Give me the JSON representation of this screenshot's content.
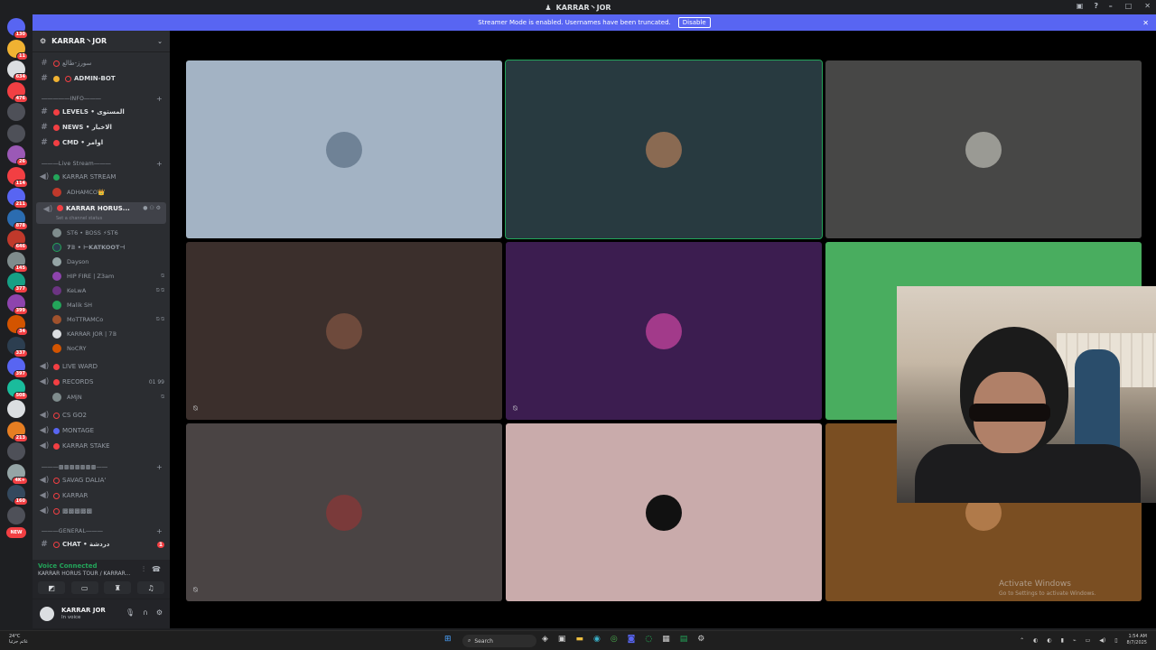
{
  "window": {
    "title": "KARRAR丶JOR"
  },
  "banner": {
    "text": "Streamer Mode is enabled. Usernames have been truncated.",
    "button": "Disable"
  },
  "guilds": [
    {
      "badge": "130",
      "color": "#5865f2"
    },
    {
      "badge": "11",
      "color": "#f0b232"
    },
    {
      "badge": "634",
      "color": "#dbdee1"
    },
    {
      "badge": "476",
      "color": "#f23f43"
    },
    {
      "badge": "",
      "color": "#4e5058"
    },
    {
      "badge": "",
      "color": "#4e5058"
    },
    {
      "badge": "26",
      "color": "#9b59b6"
    },
    {
      "badge": "114",
      "color": "#f23f43"
    },
    {
      "badge": "211",
      "color": "#5865f2"
    },
    {
      "badge": "878",
      "color": "#2b6cb0"
    },
    {
      "badge": "646",
      "color": "#c0392b"
    },
    {
      "badge": "145",
      "color": "#7f8c8d"
    },
    {
      "badge": "377",
      "color": "#16a085"
    },
    {
      "badge": "399",
      "color": "#8e44ad"
    },
    {
      "badge": "34",
      "color": "#d35400"
    },
    {
      "badge": "337",
      "color": "#2c3e50"
    },
    {
      "badge": "397",
      "color": "#5865f2"
    },
    {
      "badge": "508",
      "color": "#1abc9c"
    },
    {
      "badge": "",
      "color": "#dbdee1"
    },
    {
      "badge": "213",
      "color": "#e67e22"
    },
    {
      "badge": "",
      "color": "#4e5058"
    },
    {
      "badge": "4K+",
      "color": "#95a5a6"
    },
    {
      "badge": "160",
      "color": "#34495e"
    },
    {
      "badge": "",
      "color": "#4e5058"
    }
  ],
  "guild_new": "NEW",
  "server": {
    "name": "KARRAR丶JOR"
  },
  "channels": {
    "c1": "سورز-طالع",
    "admin_bot": "ADMIN-BOT",
    "cat_info": "INFO",
    "levels": "LEVELS • المستوى",
    "news": "NEWS • الاخبار",
    "cmd": "CMD • اوامر",
    "cat_live": "Live Stream",
    "karrar_stream": "KARRAR STREAM",
    "u_adham": "ADHAMCO👑",
    "karrar_horus": "KARRAR HORUS...",
    "set_status": "Set a channel status",
    "u_st6": "ST6 • BOSS ⚡ST6",
    "u_katkoot": "7𝔹 • ⊢KATKOOT⊣",
    "u_dayson": "Dayson",
    "u_hipfire": "HIP FIRE | Z3am",
    "u_kelwa": "KeLwA",
    "u_malik": "Malik SH",
    "u_motramco": "MoTTRAMCo",
    "u_karrarjor": "KARRAR JOR | 7𝔹",
    "u_nocry": "NoCRY",
    "live_ward": "LIVE WARD",
    "records": "RECORDS",
    "records_count": "01  99",
    "u_amjn": "AMjN",
    "csgo2": "CS GO2",
    "montage": "MONTAGE",
    "karrar_stake": "KARRAR STAKE",
    "cat_locked": "▩▩▩▩▩▩▩",
    "savag": "SAVAG DALIA'",
    "karrar": "KARRAR",
    "locked2": "▩▩▩▩▩",
    "cat_general": "GENERAL",
    "chat": "CHAT • دردشة",
    "chat_badge": "1"
  },
  "voice": {
    "status": "Voice Connected",
    "channel": "KARRAR HORUS TOUR / KARRAR..."
  },
  "user": {
    "name": "KARRAR JOR",
    "status": "In voice"
  },
  "tiles": [
    {
      "bg": "#a3b3c4",
      "avatar": "#6f8296"
    },
    {
      "bg": "#283a40",
      "avatar": "#8a6a52",
      "speaking": true
    },
    {
      "bg": "#474746",
      "avatar": "#9a9a94"
    },
    {
      "bg": "#3b2f2c",
      "avatar": "#6e4a3c",
      "mic": true
    },
    {
      "bg": "#3c1d50",
      "avatar": "#a23a8a",
      "mic": true
    },
    {
      "bg": "#49ad5f",
      "avatar": "#49ad5f"
    },
    {
      "bg": "#4a4444",
      "avatar": "#7a3a3a",
      "mic": true
    },
    {
      "bg": "#c9abab",
      "avatar": "#111111"
    },
    {
      "bg": "#7a4e22",
      "avatar": "#b07a4a"
    }
  ],
  "watermark": {
    "line1": "Activate Windows",
    "line2": "Go to Settings to activate Windows."
  },
  "taskbar": {
    "weather": "24°C",
    "weather_sub": "غائم جزئيا",
    "search": "Search",
    "time": "1:54 AM",
    "date": "8/7/2025"
  }
}
